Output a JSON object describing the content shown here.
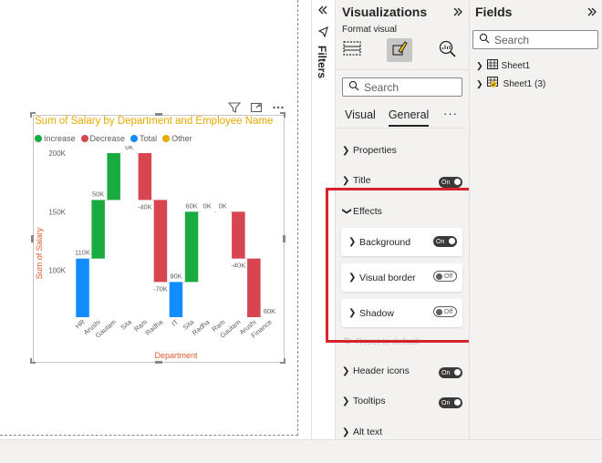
{
  "chart_data": {
    "type": "waterfall",
    "title": "Sum of Salary by Department and Employee Name",
    "xlabel": "Department",
    "ylabel": "Sum of Salary",
    "ylim": [
      60000,
      200000
    ],
    "y_ticks": [
      "100K",
      "150K",
      "200K"
    ],
    "y_tick_values": [
      100000,
      150000,
      200000
    ],
    "legend": [
      {
        "name": "Increase",
        "color": "#1aab40"
      },
      {
        "name": "Decrease",
        "color": "#d64550"
      },
      {
        "name": "Total",
        "color": "#118dff"
      },
      {
        "name": "Other",
        "color": "#e8a900"
      }
    ],
    "categories": [
      "HR",
      "Arushi",
      "Gautam",
      "Sita",
      "Ram",
      "Radha",
      "IT",
      "Sita",
      "Radha",
      "Ram",
      "Gautam",
      "Arushi",
      "Finance"
    ],
    "bars": [
      {
        "kind": "Total",
        "start": 0,
        "end": 110000,
        "label": "110K"
      },
      {
        "kind": "Increase",
        "start": 110000,
        "end": 160000,
        "label": "50K"
      },
      {
        "kind": "Increase",
        "start": 160000,
        "end": 200000,
        "label": ""
      },
      {
        "kind": "Increase",
        "start": 200000,
        "end": 200000,
        "label": "0K"
      },
      {
        "kind": "Decrease",
        "start": 200000,
        "end": 160000,
        "label": "-40K"
      },
      {
        "kind": "Decrease",
        "start": 160000,
        "end": 90000,
        "label": "-70K"
      },
      {
        "kind": "Total",
        "start": 0,
        "end": 90000,
        "label": "90K"
      },
      {
        "kind": "Increase",
        "start": 90000,
        "end": 150000,
        "label": "60K"
      },
      {
        "kind": "Increase",
        "start": 150000,
        "end": 150000,
        "label": "0K"
      },
      {
        "kind": "Increase",
        "start": 150000,
        "end": 150000,
        "label": "0K"
      },
      {
        "kind": "Decrease",
        "start": 150000,
        "end": 110000,
        "label": "-40K"
      },
      {
        "kind": "Decrease",
        "start": 110000,
        "end": 60000,
        "label": ""
      },
      {
        "kind": "Total",
        "start": 0,
        "end": 60000,
        "label": "60K"
      }
    ]
  },
  "canvas": {
    "visual_header_icons": [
      "filter-icon",
      "focus-mode-icon",
      "more-options-icon"
    ]
  },
  "filters": {
    "label": "Filters",
    "collapse_icon": "double-chevron-left-icon"
  },
  "visualizations": {
    "title": "Visualizations",
    "collapse_icon": "double-chevron-right-icon",
    "subtitle": "Format visual",
    "search_placeholder": "Search",
    "tabs": [
      "Visual",
      "General"
    ],
    "active_tab": "General",
    "more_label": "···",
    "sections": {
      "properties": "Properties",
      "title": "Title",
      "effects": "Effects",
      "background": "Background",
      "visual_border": "Visual border",
      "shadow": "Shadow",
      "reset": "Reset to default",
      "header_icons": "Header icons",
      "tooltips": "Tooltips",
      "alt_text": "Alt text"
    },
    "toggles": {
      "on": "On",
      "off": "Off"
    },
    "highlight_color": "#d8222b"
  },
  "fields": {
    "title": "Fields",
    "collapse_icon": "double-chevron-right-icon",
    "search_placeholder": "Search",
    "tables": [
      "Sheet1",
      "Sheet1 (3)"
    ]
  }
}
